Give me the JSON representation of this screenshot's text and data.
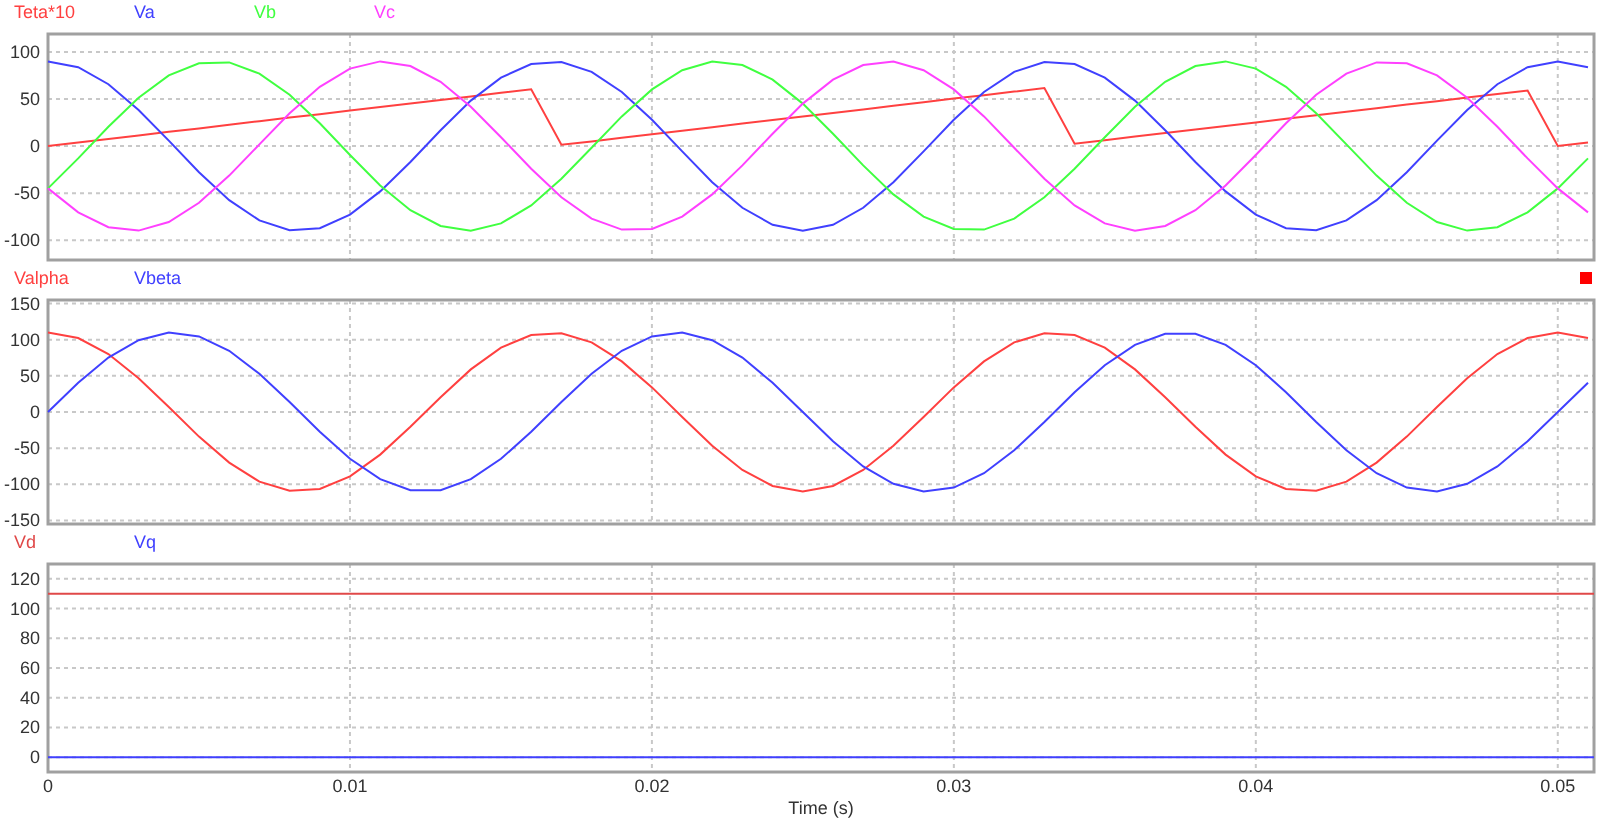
{
  "panels": [
    {
      "marker": false,
      "chart_data": {
        "type": "line",
        "x": [
          0,
          0.001,
          0.002,
          0.003,
          0.004,
          0.005,
          0.006,
          0.007,
          0.008,
          0.009,
          0.01,
          0.011,
          0.012,
          0.013,
          0.014,
          0.015,
          0.016,
          0.017,
          0.018,
          0.019,
          0.02,
          0.021,
          0.022,
          0.023,
          0.024,
          0.025,
          0.026,
          0.027,
          0.028,
          0.029,
          0.03,
          0.031,
          0.032,
          0.033,
          0.034,
          0.035,
          0.036,
          0.037,
          0.038,
          0.039,
          0.04,
          0.041,
          0.042,
          0.043,
          0.044,
          0.045,
          0.046,
          0.047,
          0.048,
          0.049,
          0.05,
          0.051
        ],
        "xlim": [
          0,
          0.0512
        ],
        "ylim": [
          -121,
          119
        ],
        "grid": true,
        "yticks": [
          -100,
          -50,
          0,
          50,
          100
        ],
        "series": [
          {
            "name": "Teta*10",
            "color": "#ff4040",
            "values": [
              0,
              3.8,
              7.5,
              11.3,
              15.1,
              18.8,
              22.6,
              26.4,
              30.2,
              33.9,
              37.7,
              41.5,
              45.2,
              49.0,
              52.8,
              56.5,
              60.3,
              1.3,
              5.0,
              8.8,
              12.6,
              16.3,
              20.1,
              23.9,
              27.6,
              31.4,
              35.2,
              39.0,
              42.7,
              46.5,
              50.3,
              54.0,
              57.8,
              61.6,
              2.5,
              6.3,
              10.1,
              13.8,
              17.6,
              21.4,
              25.1,
              28.9,
              32.7,
              36.4,
              40.2,
              44.0,
              47.7,
              51.5,
              55.3,
              59.0,
              0,
              3.8
            ]
          },
          {
            "name": "Va",
            "color": "#4040ff",
            "values": [
              90,
              83.7,
              65.6,
              38.3,
              5.7,
              -27.8,
              -57.4,
              -78.9,
              -89.3,
              -87.2,
              -72.8,
              -48.2,
              -16.9,
              16.9,
              48.2,
              72.8,
              87.2,
              89.3,
              78.9,
              57.4,
              27.8,
              -5.7,
              -38.3,
              -65.6,
              -83.7,
              -90,
              -83.7,
              -65.6,
              -38.3,
              -5.7,
              27.8,
              57.4,
              78.9,
              89.3,
              87.2,
              72.8,
              48.2,
              16.9,
              -16.9,
              -48.2,
              -72.8,
              -87.2,
              -89.3,
              -78.9,
              -57.4,
              -27.8,
              5.7,
              38.3,
              65.6,
              83.7,
              90,
              83.7
            ]
          },
          {
            "name": "Vb",
            "color": "#40ff40",
            "values": [
              -45,
              -13.1,
              20.5,
              51.3,
              75.0,
              88.0,
              88.8,
              77.0,
              54.4,
              24.2,
              -9.4,
              -41.7,
              -68.2,
              -85.0,
              -89.9,
              -82.2,
              -63.0,
              -34.8,
              -1.8,
              31.4,
              60.2,
              80.6,
              89.7,
              86.1,
              70.5,
              45,
              13.1,
              -20.5,
              -51.3,
              -75.0,
              -88.0,
              -88.8,
              -77.0,
              -54.4,
              -24.2,
              9.4,
              41.7,
              68.2,
              85.0,
              89.9,
              82.2,
              63.0,
              34.8,
              1.8,
              -31.4,
              -60.2,
              -80.6,
              -89.7,
              -86.1,
              -70.5,
              -45,
              -13.1
            ]
          },
          {
            "name": "Vc",
            "color": "#ff40ff",
            "values": [
              -45,
              -70.5,
              -86.1,
              -89.7,
              -80.6,
              -60.2,
              -31.4,
              1.8,
              34.8,
              63.0,
              82.2,
              89.9,
              85.0,
              68.2,
              41.7,
              9.4,
              -24.2,
              -54.4,
              -77.0,
              -88.8,
              -88.0,
              -75.0,
              -51.3,
              -20.5,
              13.1,
              45,
              70.5,
              86.1,
              89.7,
              80.6,
              60.2,
              31.4,
              -1.8,
              -34.8,
              -63.0,
              -82.2,
              -89.9,
              -85.0,
              -68.2,
              -41.7,
              -9.4,
              24.2,
              54.4,
              77.0,
              88.8,
              88.0,
              75.0,
              51.3,
              20.5,
              -13.1,
              -45,
              -70.5
            ]
          }
        ]
      }
    },
    {
      "marker": true,
      "chart_data": {
        "type": "line",
        "x": [
          0,
          0.001,
          0.002,
          0.003,
          0.004,
          0.005,
          0.006,
          0.007,
          0.008,
          0.009,
          0.01,
          0.011,
          0.012,
          0.013,
          0.014,
          0.015,
          0.016,
          0.017,
          0.018,
          0.019,
          0.02,
          0.021,
          0.022,
          0.023,
          0.024,
          0.025,
          0.026,
          0.027,
          0.028,
          0.029,
          0.03,
          0.031,
          0.032,
          0.033,
          0.034,
          0.035,
          0.036,
          0.037,
          0.038,
          0.039,
          0.04,
          0.041,
          0.042,
          0.043,
          0.044,
          0.045,
          0.046,
          0.047,
          0.048,
          0.049,
          0.05,
          0.051
        ],
        "xlim": [
          0,
          0.0512
        ],
        "ylim": [
          -155,
          155
        ],
        "grid": true,
        "yticks": [
          -150,
          -100,
          -50,
          0,
          50,
          100,
          150
        ],
        "series": [
          {
            "name": "Valpha",
            "color": "#ff4040",
            "values": [
              110,
              102.3,
              80.2,
              46.8,
              6.9,
              -34.0,
              -70.1,
              -96.4,
              -109.1,
              -106.5,
              -89.0,
              -58.9,
              -20.6,
              20.6,
              58.9,
              89.0,
              106.5,
              109.1,
              96.4,
              70.1,
              34.0,
              -6.9,
              -46.8,
              -80.2,
              -102.3,
              -110,
              -102.3,
              -80.2,
              -46.8,
              -6.9,
              34.0,
              70.1,
              96.4,
              109.1,
              106.5,
              89.0,
              58.9,
              20.6,
              -20.6,
              -58.9,
              -89.0,
              -106.5,
              -109.1,
              -96.4,
              -70.1,
              -34.0,
              6.9,
              46.8,
              80.2,
              102.3,
              110,
              102.3
            ]
          },
          {
            "name": "Vbeta",
            "color": "#4040ff",
            "values": [
              0,
              40.5,
              75.3,
              99.5,
              109.8,
              104.6,
              84.8,
              53.0,
              13.8,
              -27.4,
              -64.7,
              -92.9,
              -108.1,
              -108.1,
              -92.9,
              -64.7,
              -27.4,
              13.8,
              53.0,
              84.8,
              104.6,
              109.8,
              99.5,
              75.3,
              40.5,
              0,
              -40.5,
              -75.3,
              -99.5,
              -109.8,
              -104.6,
              -84.8,
              -53.0,
              -13.8,
              27.4,
              64.7,
              92.9,
              108.1,
              108.1,
              92.9,
              64.7,
              27.4,
              -13.8,
              -53.0,
              -84.8,
              -104.6,
              -109.8,
              -99.5,
              -75.3,
              -40.5,
              0,
              40.5
            ]
          }
        ]
      }
    },
    {
      "marker": false,
      "chart_data": {
        "type": "line",
        "x": [
          0,
          0.0512
        ],
        "xlim": [
          0,
          0.0512
        ],
        "ylim": [
          -10,
          130
        ],
        "xlabel": "Time (s)",
        "grid": true,
        "xticks": [
          0,
          0.01,
          0.02,
          0.03,
          0.04,
          0.05
        ],
        "yticks": [
          0,
          20,
          40,
          60,
          80,
          100,
          120
        ],
        "series": [
          {
            "name": "Vd",
            "color": "#e04848",
            "values": [
              110,
              110
            ]
          },
          {
            "name": "Vq",
            "color": "#4040ff",
            "values": [
              0,
              0
            ]
          }
        ]
      }
    }
  ]
}
